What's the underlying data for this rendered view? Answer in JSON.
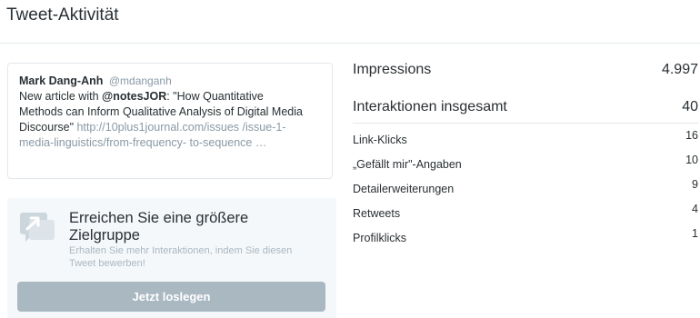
{
  "page": {
    "title": "Tweet-Aktivität"
  },
  "tweet": {
    "author_name": "Mark Dang-Anh",
    "author_handle": "@mdanganh",
    "text_prefix": "New article with ",
    "mention": "@notesJOR",
    "text_quote": ": \"How Quantitative Methods can Inform Qualitative Analysis of Digital Media Discourse\" ",
    "link": "http://10plus1journal.com/issues /issue-1-media-linguistics/from-frequency- to-sequence …"
  },
  "promo": {
    "icon": "promote-icon",
    "heading": "Erreichen Sie eine größere Zielgruppe",
    "subtext": "Erhalten Sie mehr Interaktionen, indem Sie diesen Tweet bewerben!",
    "button_label": "Jetzt loslegen"
  },
  "metrics": {
    "impressions": {
      "label": "Impressions",
      "value": "4.997"
    },
    "interactions": {
      "label": "Interaktionen insgesamt",
      "value": "40"
    },
    "breakdown": [
      {
        "label": "Link-Klicks",
        "value": "16"
      },
      {
        "label": "„Gefällt mir\"-Angaben",
        "value": "10"
      },
      {
        "label": "Detailerweiterungen",
        "value": "9"
      },
      {
        "label": "Retweets",
        "value": "4"
      },
      {
        "label": "Profilklicks",
        "value": "1"
      }
    ]
  },
  "colors": {
    "text": "#292f33",
    "muted": "#8899a6",
    "button_disabled": "#aab8c2",
    "promo_bg": "#f5f8fa",
    "divider": "#e1e8ed"
  }
}
